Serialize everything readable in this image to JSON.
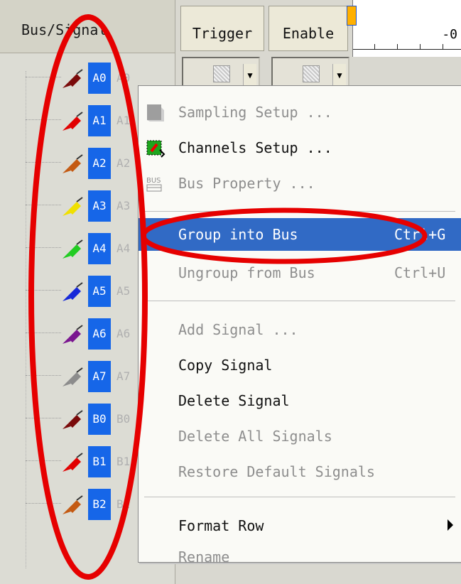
{
  "headers": {
    "bus_signal": "Bus/Signal",
    "trigger": "Trigger",
    "enable": "Enable",
    "ruler_label": "-0"
  },
  "signals": [
    {
      "label": "A0",
      "ghost": "A0",
      "color": "#7a0a0a"
    },
    {
      "label": "A1",
      "ghost": "A1",
      "color": "#e10000"
    },
    {
      "label": "A2",
      "ghost": "A2",
      "color": "#c45a12"
    },
    {
      "label": "A3",
      "ghost": "A3",
      "color": "#f0e000"
    },
    {
      "label": "A4",
      "ghost": "A4",
      "color": "#22cc22"
    },
    {
      "label": "A5",
      "ghost": "A5",
      "color": "#1628d8"
    },
    {
      "label": "A6",
      "ghost": "A6",
      "color": "#7a1590"
    },
    {
      "label": "A7",
      "ghost": "A7",
      "color": "#8c8c8c"
    },
    {
      "label": "B0",
      "ghost": "B0",
      "color": "#7a0a0a"
    },
    {
      "label": "B1",
      "ghost": "B1",
      "color": "#e10000"
    },
    {
      "label": "B2",
      "ghost": "B2",
      "color": "#c45a12"
    }
  ],
  "menu": {
    "sampling_setup": "Sampling Setup ...",
    "channels_setup": "Channels Setup ...",
    "bus_property": "Bus Property ...",
    "bus_icon_text": "BUS",
    "group_into_bus": "Group into Bus",
    "group_shortcut": "Ctrl+G",
    "ungroup_from_bus": "Ungroup from Bus",
    "ungroup_shortcut": "Ctrl+U",
    "add_signal": "Add Signal ...",
    "copy_signal": "Copy Signal",
    "delete_signal": "Delete Signal",
    "delete_all_signals": "Delete All Signals",
    "restore_default_signals": "Restore Default Signals",
    "format_row": "Format Row",
    "rename": "Rename"
  },
  "colors": {
    "highlight": "#316ac5",
    "chip": "#1666e8",
    "annotation": "#e60000"
  }
}
